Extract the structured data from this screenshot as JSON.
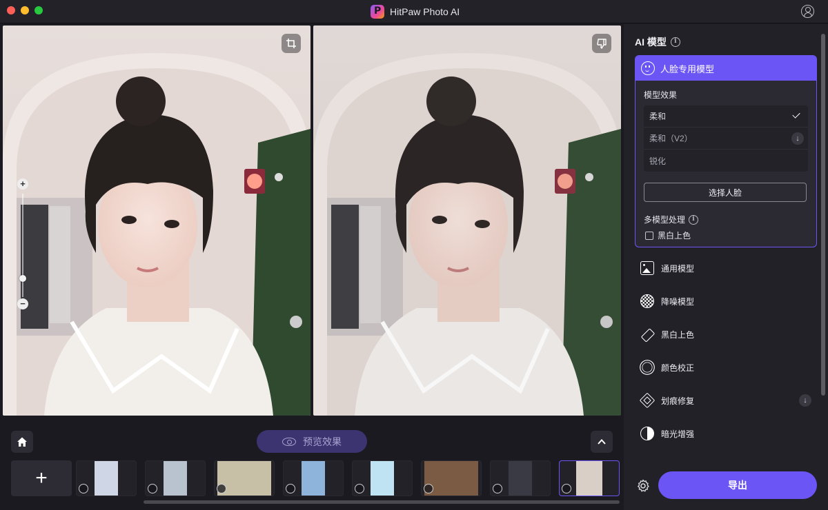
{
  "window": {
    "title": "HitPaw Photo AI"
  },
  "preview": {
    "label": "预览效果"
  },
  "panel": {
    "heading": "AI 模型",
    "face_model": {
      "title": "人脸专用模型",
      "effect_label": "模型效果",
      "options": [
        {
          "label": "柔和",
          "selected": true
        },
        {
          "label": "柔和（V2）",
          "selected": false,
          "downloadable": true
        },
        {
          "label": "锐化",
          "selected": false
        }
      ],
      "select_face_label": "选择人脸",
      "multi_label": "多模型处理",
      "bw_label": "黑白上色"
    },
    "models": [
      {
        "label": "通用模型",
        "icon": "image-icon"
      },
      {
        "label": "降噪模型",
        "icon": "denoise-icon"
      },
      {
        "label": "黑白上色",
        "icon": "eraser-icon"
      },
      {
        "label": "颜色校正",
        "icon": "sun-icon"
      },
      {
        "label": "划痕修复",
        "icon": "scratch-icon",
        "downloadable": true
      },
      {
        "label": "暗光增强",
        "icon": "half-circle-icon"
      }
    ],
    "export_label": "导出"
  },
  "thumbnails": [
    {
      "bg": "#cfd7e6",
      "badge": "eraser"
    },
    {
      "bg": "#b9c2cf",
      "badge": "eraser"
    },
    {
      "bg": "#c8c0a6",
      "badge": "eraser"
    },
    {
      "bg": "#8fb4dc",
      "badge": "eraser"
    },
    {
      "bg": "#bfe3f2",
      "badge": "eraser"
    },
    {
      "bg": "#7c5b44",
      "badge": "eraser"
    },
    {
      "bg": "#3a3a44",
      "badge": "dots"
    },
    {
      "bg": "#d9cfc7",
      "badge": "face",
      "active": true
    }
  ]
}
